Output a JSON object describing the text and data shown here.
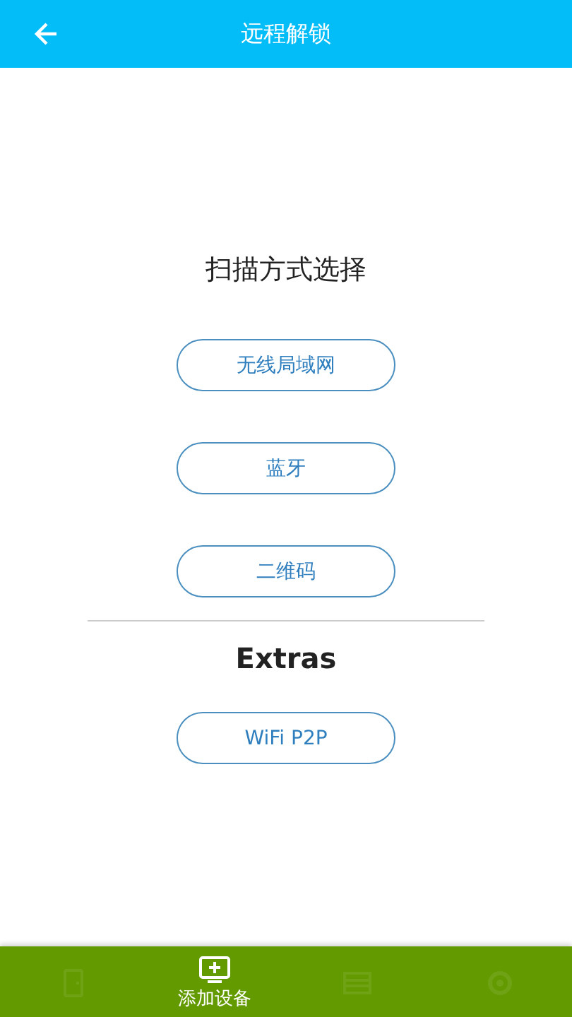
{
  "header": {
    "title": "远程解锁"
  },
  "scan": {
    "heading": "扫描方式选择",
    "buttons": [
      "无线局域网",
      "蓝牙",
      "二维码"
    ]
  },
  "extras": {
    "heading": "Extras",
    "buttons": [
      "WiFi P2P"
    ]
  },
  "bottom_nav": [
    {
      "kind": "door",
      "selected": false
    },
    {
      "kind": "add-device",
      "selected": true,
      "label": "添加设备"
    },
    {
      "kind": "list",
      "selected": false
    },
    {
      "kind": "gear",
      "selected": false
    }
  ]
}
